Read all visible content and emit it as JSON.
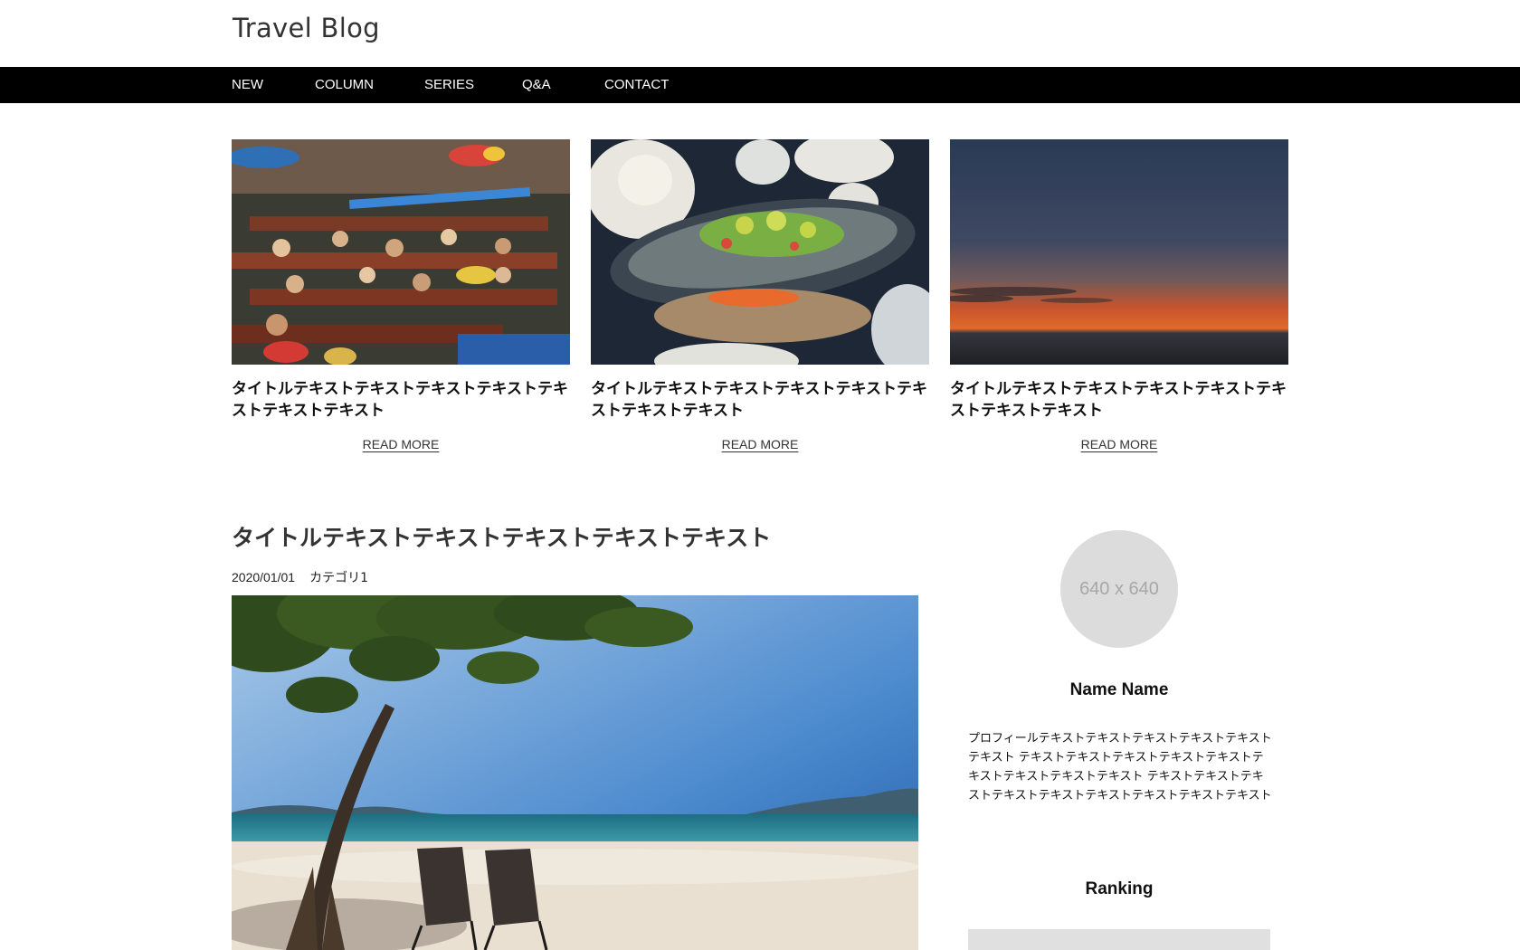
{
  "site": {
    "title": "Travel Blog"
  },
  "nav": {
    "items": [
      {
        "label": "NEW"
      },
      {
        "label": "COLUMN"
      },
      {
        "label": "SERIES"
      },
      {
        "label": "Q&A"
      },
      {
        "label": "CONTACT"
      }
    ]
  },
  "cards": [
    {
      "title": "タイトルテキストテキストテキストテキストテキストテキストテキスト",
      "read_more": "READ MORE",
      "image": "floating-market-photo"
    },
    {
      "title": "タイトルテキストテキストテキストテキストテキストテキストテキスト",
      "read_more": "READ MORE",
      "image": "grilled-fish-dish-photo"
    },
    {
      "title": "タイトルテキストテキストテキストテキストテキストテキストテキスト",
      "read_more": "READ MORE",
      "image": "sunset-sea-photo"
    }
  ],
  "post": {
    "title": "タイトルテキストテキストテキストテキストテキスト",
    "date": "2020/01/01",
    "category": "カテゴリ1",
    "image": "beach-chairs-photo"
  },
  "profile": {
    "avatar_placeholder": "640 x 640",
    "name": "Name Name",
    "text": "プロフィールテキストテキストテキストテキストテキストテキスト テキストテキストテキストテキストテキストテキストテキストテキストテキスト テキストテキストテキストテキストテキストテキストテキストテキストテキスト"
  },
  "ranking": {
    "title": "Ranking"
  },
  "colors": {
    "nav_background": "#000000",
    "nav_text": "#ffffff",
    "avatar_background": "#dcdcdc",
    "ranking_box": "#e0e0e0"
  }
}
